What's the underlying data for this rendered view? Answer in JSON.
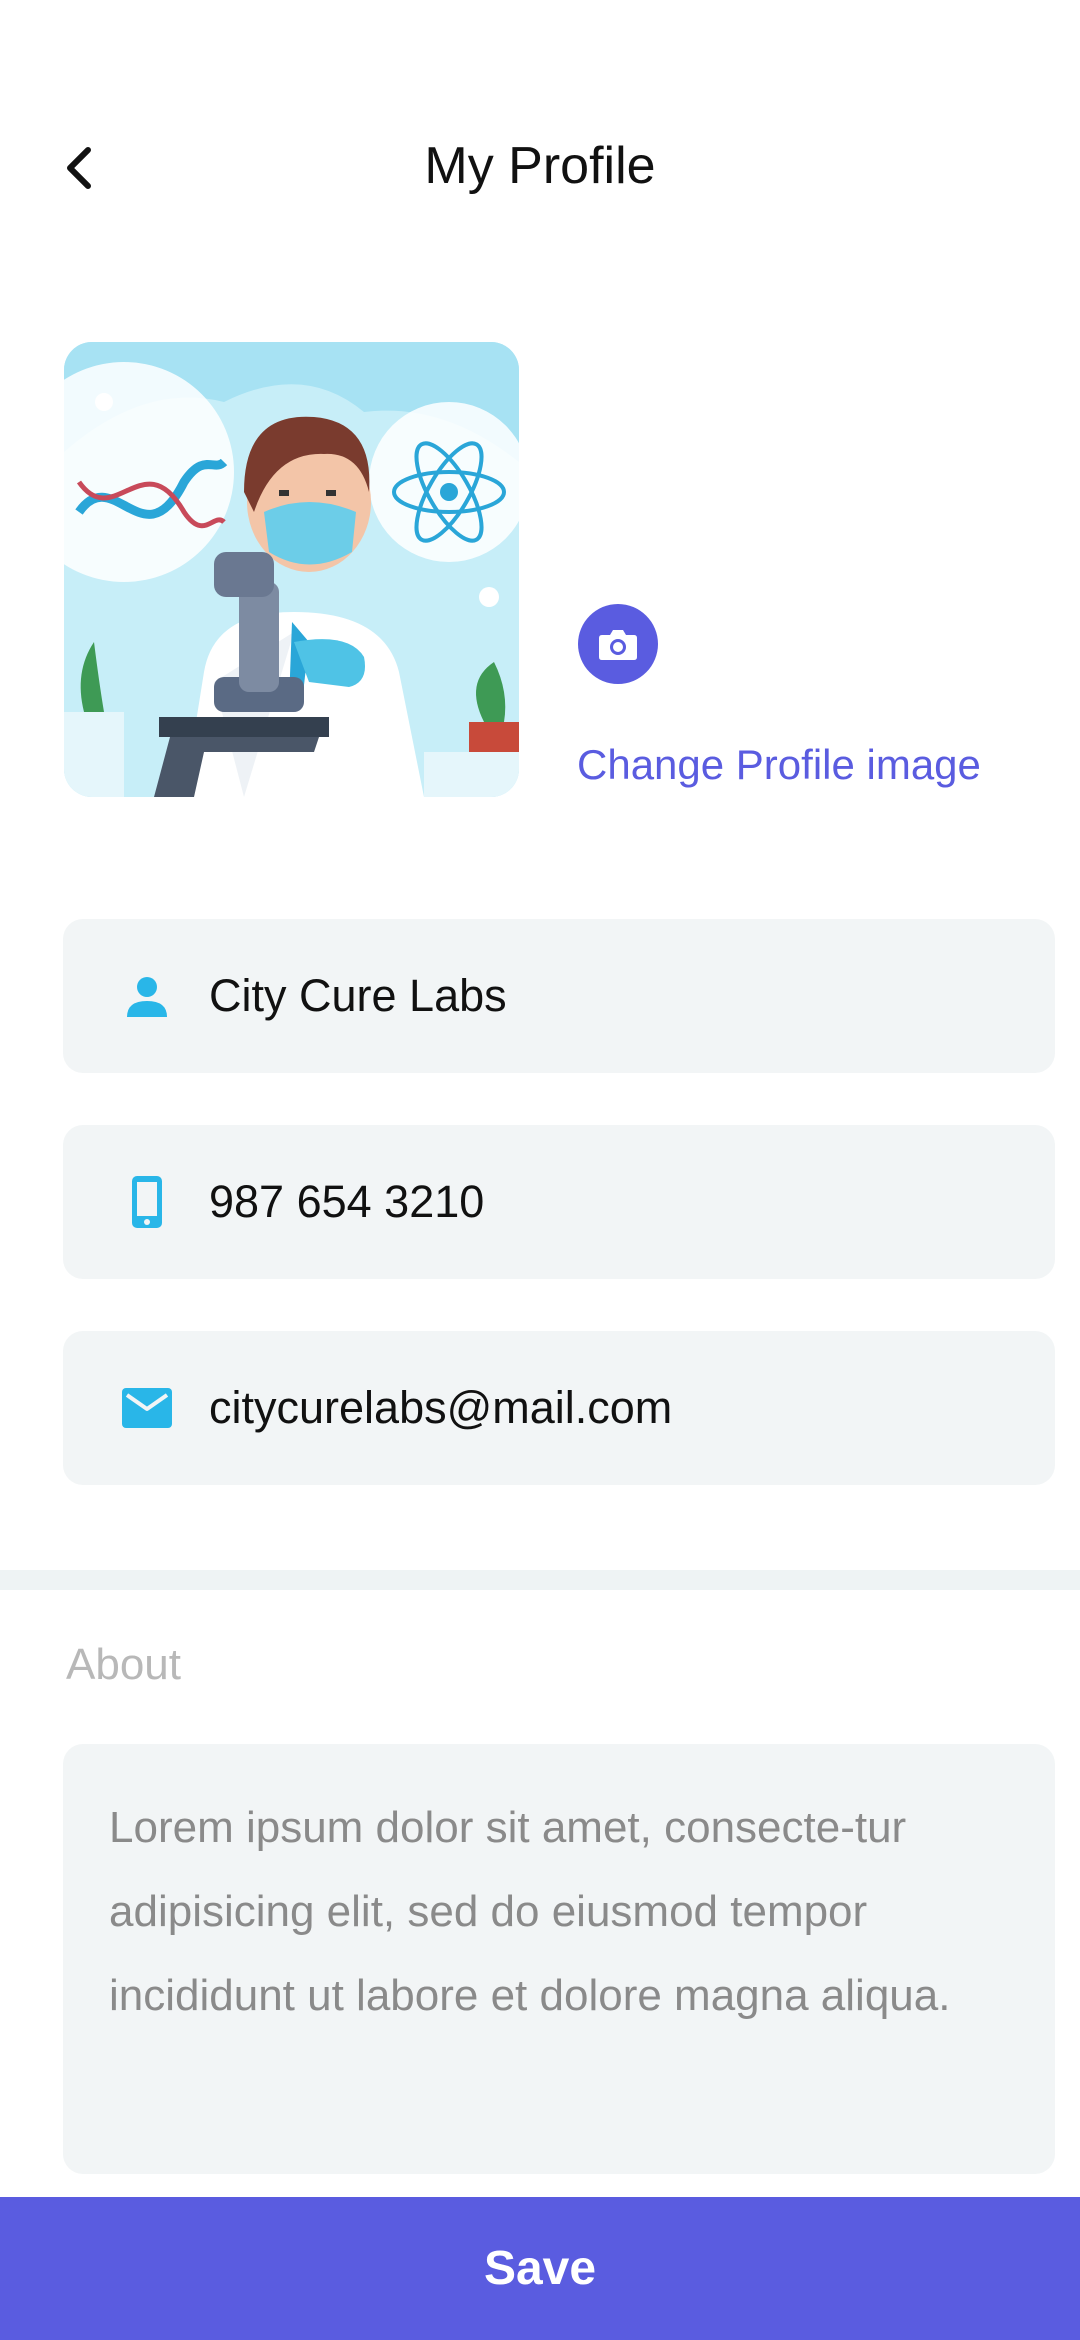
{
  "header": {
    "title": "My Profile",
    "back_icon": "chevron-left-icon"
  },
  "profile_image": {
    "alt": "Scientist with microscope illustration",
    "change_label": "Change Profile image",
    "camera_icon": "camera-icon"
  },
  "fields": {
    "name": {
      "icon": "person-icon",
      "value": "City Cure Labs"
    },
    "phone": {
      "icon": "phone-icon",
      "value": "987 654 3210"
    },
    "email": {
      "icon": "mail-icon",
      "value": "citycurelabs@mail.com"
    }
  },
  "about": {
    "label": "About",
    "text": "Lorem ipsum dolor sit amet, consecte-tur adipisicing elit, sed do eiusmod tempor incididunt ut labore et dolore magna aliqua."
  },
  "actions": {
    "save_label": "Save"
  },
  "colors": {
    "accent": "#5a5ce0",
    "icon": "#29b6e8",
    "field_bg": "#f2f5f6"
  }
}
